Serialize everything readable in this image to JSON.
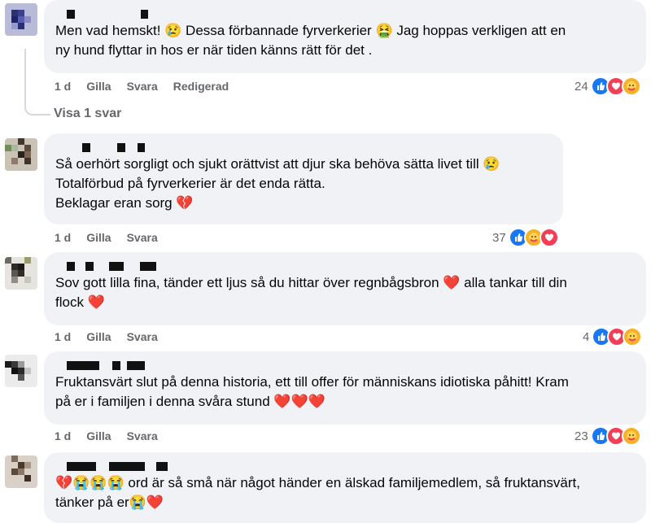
{
  "comments": [
    {
      "text": "Men vad hemskt! 😢 Dessa förbannade fyrverkerier 🤮 Jag hoppas verkligen att en\nny hund flyttar in hos er när tiden känns rätt för det .",
      "actions": {
        "time": "1 d",
        "like": "Gilla",
        "reply": "Svara",
        "edited": "Redigerad"
      },
      "reaction_count": "24",
      "reactions": [
        "like",
        "love",
        "care"
      ]
    },
    {
      "text": "Så oerhört sorgligt och sjukt orättvist att djur ska behöva sätta livet till 😢\nTotalförbud på fyrverkerier är det enda rätta.\nBeklagar eran sorg 💔",
      "actions": {
        "time": "1 d",
        "like": "Gilla",
        "reply": "Svara"
      },
      "reaction_count": "37",
      "reactions": [
        "like",
        "care",
        "love"
      ]
    },
    {
      "text": "Sov gott lilla fina, tänder ett ljus så du hittar över regnbågsbron ❤️ alla tankar till din\nflock ❤️",
      "actions": {
        "time": "1 d",
        "like": "Gilla",
        "reply": "Svara"
      },
      "reaction_count": "4",
      "reactions": [
        "like",
        "love",
        "care"
      ]
    },
    {
      "text": "Fruktansvärt slut på denna historia, ett till offer för människans idiotiska påhitt! Kram\npå er i familjen i denna svåra stund ❤️❤️❤️",
      "actions": {
        "time": "1 d",
        "like": "Gilla",
        "reply": "Svara"
      },
      "reaction_count": "23",
      "reactions": [
        "like",
        "love",
        "care"
      ]
    },
    {
      "text": "💔😭😭😭 ord är så små när något händer en älskad familjemedlem, så fruktansvärt,\ntänker på er😭❤️",
      "actions": {}
    }
  ],
  "view_replies": "Visa 1 svar",
  "colors": {
    "bubble": "#f0f2f5",
    "meta": "#65676b",
    "like": "#1877f2",
    "love": "#f33e58",
    "care": "#f7b125"
  },
  "icons": [
    "like-icon",
    "love-icon",
    "care-icon"
  ]
}
